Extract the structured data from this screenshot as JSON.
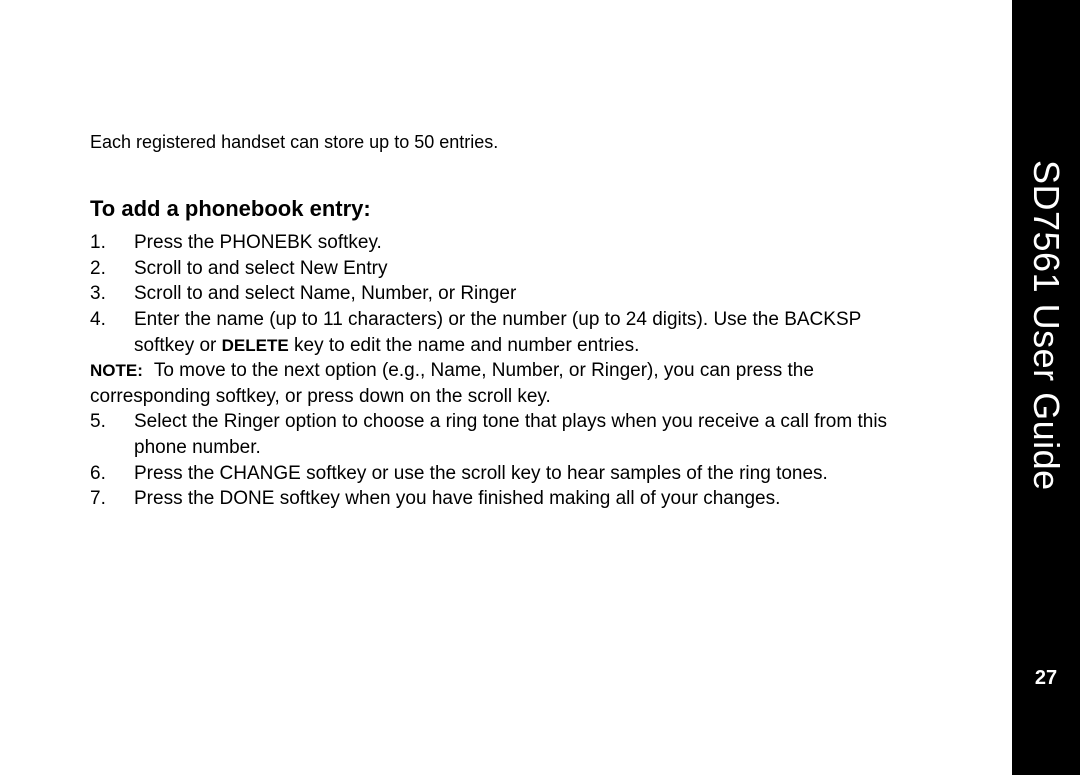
{
  "sidebar": {
    "title": "SD7561 User Guide",
    "page_number": "27"
  },
  "intro": "Each registered handset can store up to 50 entries.",
  "section_heading": "To add a phonebook entry:",
  "steps": {
    "s1": {
      "num": "1.",
      "a": "Press the ",
      "sk1": "PHONEBK",
      "b": " softkey."
    },
    "s2": {
      "num": "2.",
      "a": "Scroll to and select ",
      "sk1": "New Entry"
    },
    "s3": {
      "num": "3.",
      "a": "Scroll to and select ",
      "sk1": "Name",
      "b": ", ",
      "sk2": "Number",
      "c": ", or ",
      "sk3": "Ringer"
    },
    "s4": {
      "num": "4.",
      "a": "Enter the name (up to 11 characters) or the number (up to 24 digits). Use the ",
      "sk1": "BACKSP",
      "b": " softkey or ",
      "hw": "DELETE",
      "c": " key to edit the name and number entries."
    },
    "note": {
      "label": "NOTE:",
      "a": " To move to the next option (e.g., ",
      "sk1": "Name",
      "b": ", ",
      "sk2": "Number",
      "c": ", or ",
      "sk3": "Ringer",
      "d": "), you can press the corresponding softkey, or press down on the scroll key."
    },
    "s5": {
      "num": "5.",
      "a": "Select the ",
      "sk1": "Ringer",
      "b": " option to choose a ring tone that plays when you receive a call from this phone number."
    },
    "s6": {
      "num": "6.",
      "a": "Press the ",
      "sk1": "CHANGE",
      "b": " softkey or use the scroll key to hear samples of the ring tones."
    },
    "s7": {
      "num": "7.",
      "a": "Press the ",
      "sk1": "DONE",
      "b": " softkey when you have finished making all of your changes."
    }
  }
}
